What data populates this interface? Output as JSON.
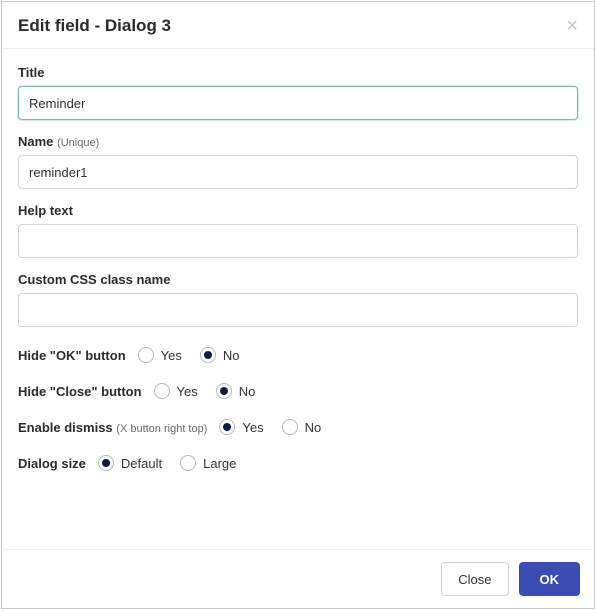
{
  "header": {
    "title": "Edit field - Dialog 3"
  },
  "fields": {
    "title": {
      "label": "Title",
      "value": "Reminder"
    },
    "name": {
      "label": "Name",
      "hint": "(Unique)",
      "value": "reminder1"
    },
    "help": {
      "label": "Help text",
      "value": ""
    },
    "css": {
      "label": "Custom CSS class name",
      "value": ""
    }
  },
  "radios": {
    "hide_ok": {
      "label": "Hide \"OK\" button",
      "yes": "Yes",
      "no": "No",
      "selected": "no"
    },
    "hide_close": {
      "label": "Hide \"Close\" button",
      "yes": "Yes",
      "no": "No",
      "selected": "no"
    },
    "dismiss": {
      "label": "Enable dismiss",
      "hint": "(X button right top)",
      "yes": "Yes",
      "no": "No",
      "selected": "yes"
    },
    "size": {
      "label": "Dialog size",
      "opt_default": "Default",
      "opt_large": "Large",
      "selected": "default"
    }
  },
  "footer": {
    "close": "Close",
    "ok": "OK"
  }
}
